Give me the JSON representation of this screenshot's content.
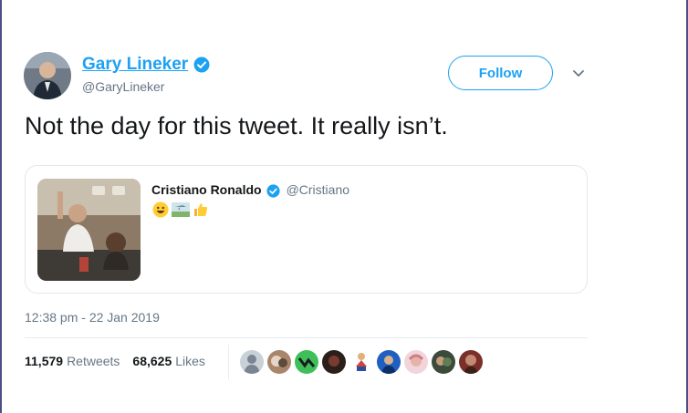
{
  "top_cut_text": "… ... ... ... ... ...",
  "author": {
    "display_name": "Gary Lineker",
    "handle": "@GaryLineker",
    "verified": true
  },
  "actions": {
    "follow_label": "Follow",
    "menu_icon": "chevron-down-icon"
  },
  "tweet": {
    "text": "Not the day for this tweet. It really isn’t.",
    "timestamp": "12:38 pm - 22 Jan 2019"
  },
  "quoted_tweet": {
    "display_name": "Cristiano Ronaldo",
    "handle": "@Cristiano",
    "verified": true,
    "emojis": [
      "grinning-face",
      "airplane-sign",
      "thumbs-up"
    ]
  },
  "stats": {
    "retweets_count": "11,579",
    "retweets_label": "Retweets",
    "likes_count": "68,625",
    "likes_label": "Likes"
  },
  "likers_count": 9,
  "colors": {
    "accent": "#1da1f2",
    "text": "#14171a",
    "muted": "#657786",
    "border": "#e1e8ed",
    "frame": "#4d4f86"
  }
}
